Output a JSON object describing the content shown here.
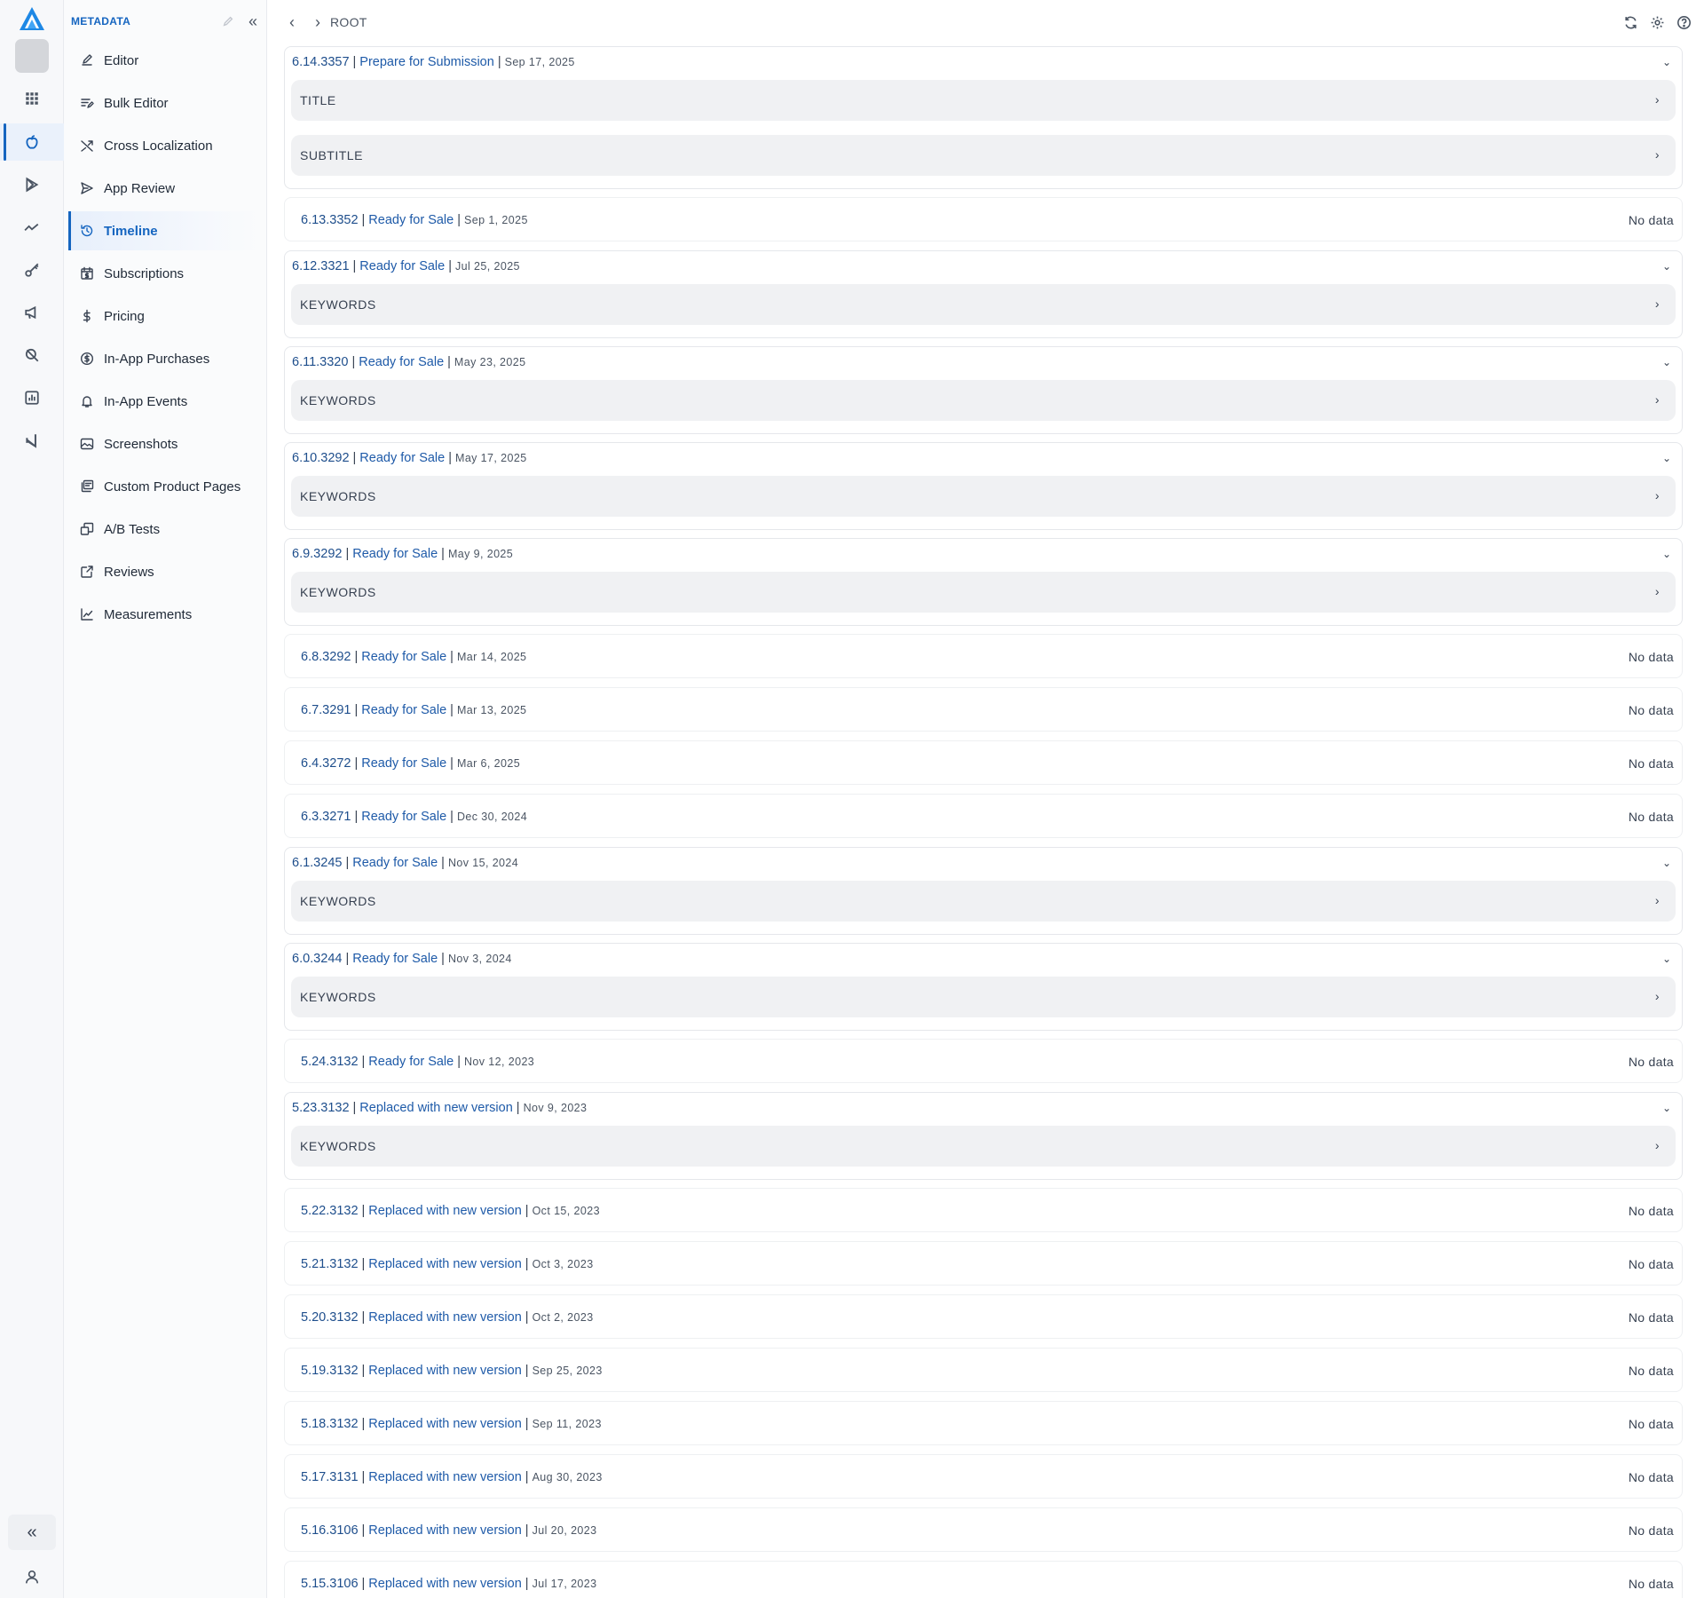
{
  "rail": {
    "icons": [
      "grid-icon",
      "apple-icon",
      "play-store-icon",
      "trend-icon",
      "key-icon",
      "megaphone-icon",
      "search-tools-icon",
      "report-icon",
      "vscode-icon"
    ],
    "active_index": 1,
    "collapse_glyph": "«"
  },
  "sidebar": {
    "title": "METADATA",
    "collapse_glyph": "«",
    "items": [
      {
        "label": "Editor",
        "icon": "pen-icon"
      },
      {
        "label": "Bulk Editor",
        "icon": "list-edit-icon"
      },
      {
        "label": "Cross Localization",
        "icon": "shuffle-icon"
      },
      {
        "label": "App Review",
        "icon": "send-icon"
      },
      {
        "label": "Timeline",
        "icon": "history-icon"
      },
      {
        "label": "Subscriptions",
        "icon": "calendar-dollar-icon"
      },
      {
        "label": "Pricing",
        "icon": "dollar-icon"
      },
      {
        "label": "In-App Purchases",
        "icon": "coin-icon"
      },
      {
        "label": "In-App Events",
        "icon": "bell-icon"
      },
      {
        "label": "Screenshots",
        "icon": "image-icon"
      },
      {
        "label": "Custom Product Pages",
        "icon": "pages-icon"
      },
      {
        "label": "A/B Tests",
        "icon": "ab-icon"
      },
      {
        "label": "Reviews",
        "icon": "review-icon"
      },
      {
        "label": "Measurements",
        "icon": "chart-line-icon"
      }
    ],
    "active": "Timeline"
  },
  "topbar": {
    "back_glyph": "‹",
    "forward_glyph": "›",
    "breadcrumb": "ROOT"
  },
  "timeline": {
    "no_data_label": "No data",
    "sep": "|",
    "entries": [
      {
        "version": "6.14.3357",
        "status": "Prepare for Submission",
        "date": "Sep 17, 2025",
        "fields": [
          "TITLE",
          "SUBTITLE"
        ]
      },
      {
        "version": "6.13.3352",
        "status": "Ready for Sale",
        "date": "Sep 1, 2025",
        "fields": []
      },
      {
        "version": "6.12.3321",
        "status": "Ready for Sale",
        "date": "Jul 25, 2025",
        "fields": [
          "KEYWORDS"
        ]
      },
      {
        "version": "6.11.3320",
        "status": "Ready for Sale",
        "date": "May 23, 2025",
        "fields": [
          "KEYWORDS"
        ]
      },
      {
        "version": "6.10.3292",
        "status": "Ready for Sale",
        "date": "May 17, 2025",
        "fields": [
          "KEYWORDS"
        ]
      },
      {
        "version": "6.9.3292",
        "status": "Ready for Sale",
        "date": "May 9, 2025",
        "fields": [
          "KEYWORDS"
        ]
      },
      {
        "version": "6.8.3292",
        "status": "Ready for Sale",
        "date": "Mar 14, 2025",
        "fields": []
      },
      {
        "version": "6.7.3291",
        "status": "Ready for Sale",
        "date": "Mar 13, 2025",
        "fields": []
      },
      {
        "version": "6.4.3272",
        "status": "Ready for Sale",
        "date": "Mar 6, 2025",
        "fields": []
      },
      {
        "version": "6.3.3271",
        "status": "Ready for Sale",
        "date": "Dec 30, 2024",
        "fields": []
      },
      {
        "version": "6.1.3245",
        "status": "Ready for Sale",
        "date": "Nov 15, 2024",
        "fields": [
          "KEYWORDS"
        ]
      },
      {
        "version": "6.0.3244",
        "status": "Ready for Sale",
        "date": "Nov 3, 2024",
        "fields": [
          "KEYWORDS"
        ]
      },
      {
        "version": "5.24.3132",
        "status": "Ready for Sale",
        "date": "Nov 12, 2023",
        "fields": []
      },
      {
        "version": "5.23.3132",
        "status": "Replaced with new version",
        "date": "Nov 9, 2023",
        "fields": [
          "KEYWORDS"
        ]
      },
      {
        "version": "5.22.3132",
        "status": "Replaced with new version",
        "date": "Oct 15, 2023",
        "fields": []
      },
      {
        "version": "5.21.3132",
        "status": "Replaced with new version",
        "date": "Oct 3, 2023",
        "fields": []
      },
      {
        "version": "5.20.3132",
        "status": "Replaced with new version",
        "date": "Oct 2, 2023",
        "fields": []
      },
      {
        "version": "5.19.3132",
        "status": "Replaced with new version",
        "date": "Sep 25, 2023",
        "fields": []
      },
      {
        "version": "5.18.3132",
        "status": "Replaced with new version",
        "date": "Sep 11, 2023",
        "fields": []
      },
      {
        "version": "5.17.3131",
        "status": "Replaced with new version",
        "date": "Aug 30, 2023",
        "fields": []
      },
      {
        "version": "5.16.3106",
        "status": "Replaced with new version",
        "date": "Jul 20, 2023",
        "fields": []
      },
      {
        "version": "5.15.3106",
        "status": "Replaced with new version",
        "date": "Jul 17, 2023",
        "fields": []
      }
    ]
  },
  "colors": {
    "accent": "#1565c0",
    "version_text": "#1e4e8c",
    "field_bg": "#f0f1f3"
  }
}
